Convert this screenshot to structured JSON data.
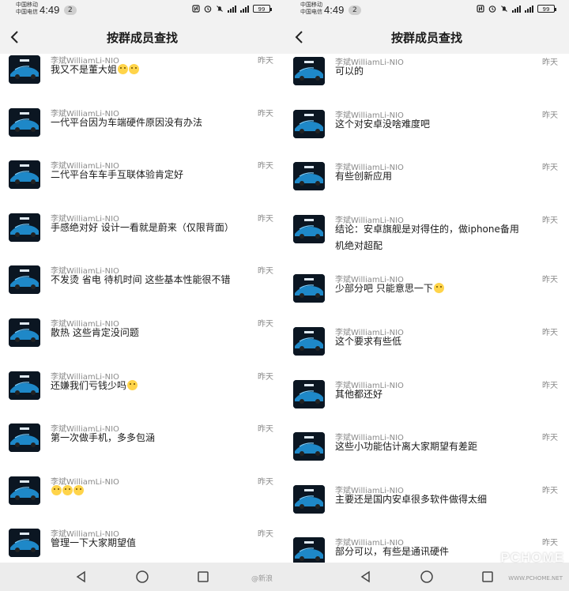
{
  "status_bar": {
    "carrier_1": "中国移动",
    "carrier_2": "中国电信",
    "time": "4:49",
    "notification_count": "2",
    "battery": "99"
  },
  "header": {
    "title": "按群成员查找"
  },
  "left_panel": {
    "messages": [
      {
        "sender": "李斌WilliamLi-NIO",
        "time": "昨天",
        "text": "我又不是董大姐",
        "emojis": 2
      },
      {
        "sender": "李斌WilliamLi-NIO",
        "time": "昨天",
        "text": "一代平台因为车端硬件原因没有办法"
      },
      {
        "sender": "李斌WilliamLi-NIO",
        "time": "昨天",
        "text": "二代平台车车手互联体验肯定好"
      },
      {
        "sender": "李斌WilliamLi-NIO",
        "time": "昨天",
        "text": "手感绝对好 设计一看就是蔚来（仅限背面）"
      },
      {
        "sender": "李斌WilliamLi-NIO",
        "time": "昨天",
        "text": "不发烫 省电 待机时间 这些基本性能很不错"
      },
      {
        "sender": "李斌WilliamLi-NIO",
        "time": "昨天",
        "text": "散热 这些肯定没问题"
      },
      {
        "sender": "李斌WilliamLi-NIO",
        "time": "昨天",
        "text": "还嫌我们亏钱少吗",
        "emojis": 1
      },
      {
        "sender": "李斌WilliamLi-NIO",
        "time": "昨天",
        "text": "第一次做手机，多多包涵"
      },
      {
        "sender": "李斌WilliamLi-NIO",
        "time": "昨天",
        "text": "",
        "emojis": 3
      },
      {
        "sender": "李斌WilliamLi-NIO",
        "time": "昨天",
        "text": "管理一下大家期望值"
      }
    ]
  },
  "right_panel": {
    "messages": [
      {
        "sender": "李斌WilliamLi-NIO",
        "time": "昨天",
        "text": "可以的"
      },
      {
        "sender": "李斌WilliamLi-NIO",
        "time": "昨天",
        "text": "这个对安卓没啥难度吧"
      },
      {
        "sender": "李斌WilliamLi-NIO",
        "time": "昨天",
        "text": "有些创新应用"
      },
      {
        "sender": "李斌WilliamLi-NIO",
        "time": "昨天",
        "text": "结论：安卓旗舰是对得住的，做iphone备用",
        "text2": "机绝对超配"
      },
      {
        "sender": "李斌WilliamLi-NIO",
        "time": "昨天",
        "text": "少部分吧 只能意思一下",
        "emojis": 1
      },
      {
        "sender": "李斌WilliamLi-NIO",
        "time": "昨天",
        "text": "这个要求有些低"
      },
      {
        "sender": "李斌WilliamLi-NIO",
        "time": "昨天",
        "text": "其他都还好"
      },
      {
        "sender": "李斌WilliamLi-NIO",
        "time": "昨天",
        "text": "这些小功能估计离大家期望有差距"
      },
      {
        "sender": "李斌WilliamLi-NIO",
        "time": "昨天",
        "text": "主要还是国内安卓很多软件做得太细"
      },
      {
        "sender": "李斌WilliamLi-NIO",
        "time": "昨天",
        "text": "部分可以，有些是通讯硬件"
      }
    ]
  },
  "watermark": {
    "weibo": "@新浪",
    "brand": "PCHOME",
    "url": "WWW.PCHOME.NET"
  },
  "colors": {
    "background": "#ffffff",
    "bar": "#f2f2f2",
    "secondary_text": "#8a8a8a"
  }
}
